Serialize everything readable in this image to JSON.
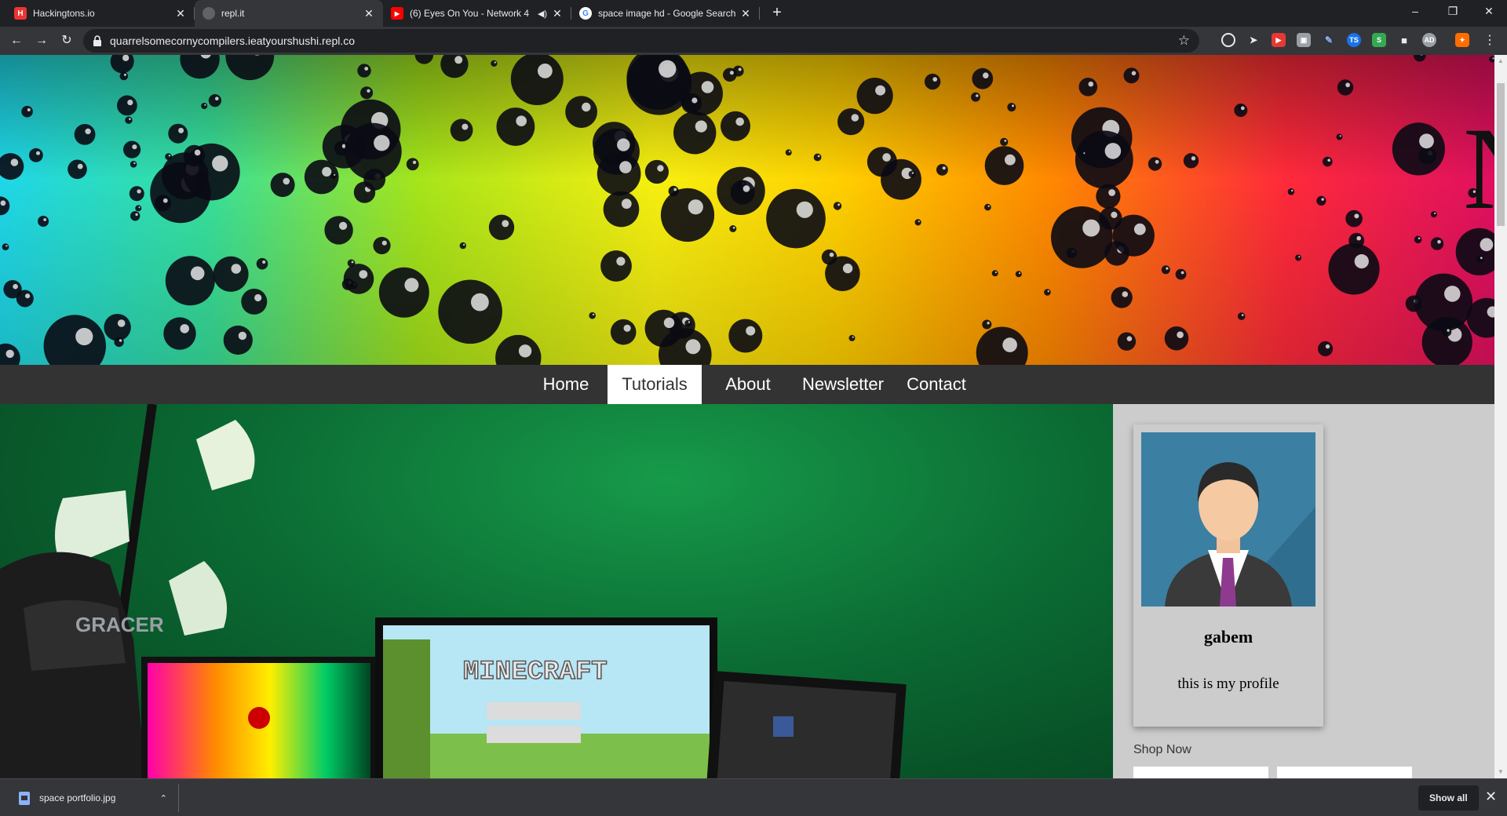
{
  "browser": {
    "tabs": [
      {
        "title": "Hackingtons.io",
        "favicon": "hackingtons-icon",
        "active": false
      },
      {
        "title": "repl.it",
        "favicon": "globe-icon",
        "active": true
      },
      {
        "title": "(6) Eyes On You - Network 4",
        "favicon": "youtube-icon",
        "active": false
      },
      {
        "title": "space image hd - Google Search",
        "favicon": "google-icon",
        "active": false
      }
    ],
    "close_glyph": "✕",
    "new_tab_glyph": "+",
    "url": "quarrelsomecornycompilers.ieatyourshushi.repl.co",
    "window_controls": {
      "minimize": "–",
      "restore": "❐",
      "close": "✕"
    }
  },
  "site": {
    "banner_letter": "N",
    "nav": [
      "Home",
      "Tutorials",
      "About",
      "Newsletter",
      "Contact"
    ],
    "active_nav": "Tutorials",
    "hero_text": "MINECRAFT",
    "chair_text": "GRACER",
    "profile": {
      "name": "gabem",
      "bio": "this is my profile"
    },
    "shop_label": "Shop Now"
  },
  "downloads": {
    "file": "space portfolio.jpg",
    "show_all": "Show all",
    "close_glyph": "✕",
    "caret_glyph": "⌃"
  },
  "colors": {
    "navbar": "#333333",
    "sidebar": "#cccccc",
    "chrome_dark": "#202124",
    "chrome_toolbar": "#35363a"
  }
}
